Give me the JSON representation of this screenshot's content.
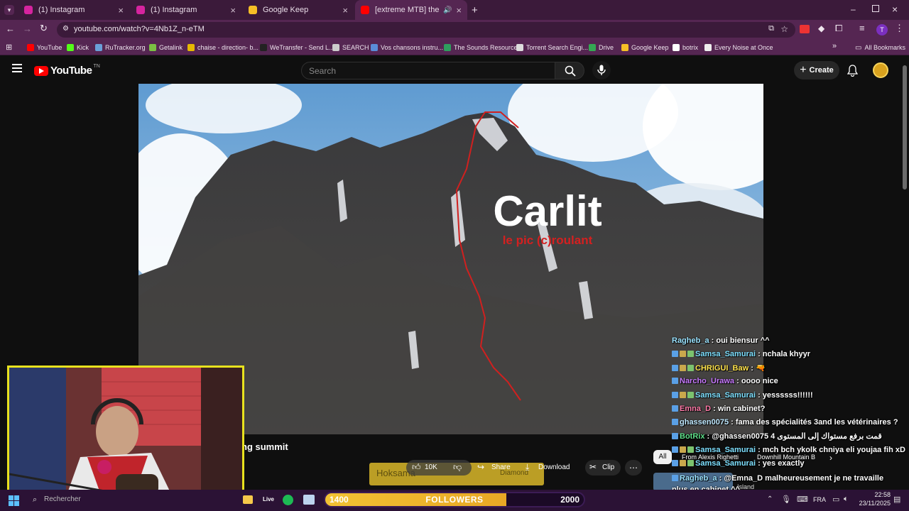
{
  "tabs": [
    {
      "title": "(1) Instagram",
      "color": "#d6249f"
    },
    {
      "title": "(1) Instagram",
      "color": "#d6249f"
    },
    {
      "title": "Google Keep",
      "color": "#f6bf26"
    },
    {
      "title": "[extreme MTB] the Carlit pe",
      "color": "#ff0000"
    }
  ],
  "browser": {
    "url": "youtube.com/watch?v=4Nb1Z_n-eTM",
    "all_bookmarks": "All Bookmarks"
  },
  "bookmarks": [
    {
      "label": "YouTube",
      "color": "#ff0000"
    },
    {
      "label": "Kick",
      "color": "#53fc18"
    },
    {
      "label": "RuTracker.org",
      "color": "#6aa0d8"
    },
    {
      "label": "Getalink",
      "color": "#7bc043"
    },
    {
      "label": "chaise - direction- b...",
      "color": "#e6b800"
    },
    {
      "label": "WeTransfer - Send L...",
      "color": "#222222"
    },
    {
      "label": "SEARCH",
      "color": "#cccccc"
    },
    {
      "label": "Vos chansons instru...",
      "color": "#5a8cd8"
    },
    {
      "label": "The Sounds Resource",
      "color": "#2e9e5e"
    },
    {
      "label": "Torrent Search Engi...",
      "color": "#dddddd"
    },
    {
      "label": "Drive",
      "color": "#34a853"
    },
    {
      "label": "Google Keep",
      "color": "#f6bf26"
    },
    {
      "label": "botrix",
      "color": "#ffffff"
    },
    {
      "label": "Every Noise at Once",
      "color": "#eeeeee"
    }
  ],
  "youtube": {
    "logo": "YouTube",
    "logo_sup": "TN",
    "search_placeholder": "Search",
    "create": "Create",
    "avatar_initials": "T"
  },
  "video": {
    "title_big": "Carlit",
    "subtitle": "le pic (c)roulant",
    "below_title": "ng summit",
    "likes": "10K",
    "share": "Share",
    "download": "Download",
    "clip": "Clip",
    "overlay_text": "Hoksama",
    "overlay_text2": "Diamond",
    "filter_all": "All",
    "rec1": "From Alexis Righetti",
    "rec2": "Downhill Mountain B",
    "rec3": "Island"
  },
  "chat": [
    {
      "user": "Ragheb_a",
      "color": "#9be3ff",
      "msg": ": oui biensur ^^"
    },
    {
      "user": "Samsa_Samurai",
      "color": "#7ee0ff",
      "msg": ": nchala khyyr"
    },
    {
      "user": "CHRIGUI_Baw",
      "color": "#ffe34d",
      "msg": ": 🔫"
    },
    {
      "user": "Narcho_Urawa",
      "color": "#c879ff",
      "msg": ": oooo nice"
    },
    {
      "user": "Samsa_Samurai",
      "color": "#7ee0ff",
      "msg": ": yessssss!!!!!!"
    },
    {
      "user": "Emna_D",
      "color": "#ff7aa8",
      "msg": ": win cabinet?"
    },
    {
      "user": "ghassen0075",
      "color": "#bfe8ff",
      "msg": ": fama des spécialités 3and les vétérinaires ?"
    },
    {
      "user": "BotRix",
      "color": "#5fe08a",
      "msg": ": @ghassen0075 قمت برفع مستواك إلى المستوى 4"
    },
    {
      "user": "Samsa_Samurai",
      "color": "#7ee0ff",
      "msg": ": mch bch ykolk chniya eli youjaa fih xD"
    },
    {
      "user": "Samsa_Samurai",
      "color": "#7ee0ff",
      "msg": ": yes exactly"
    },
    {
      "user": "Ragheb_a",
      "color": "#9be3ff",
      "msg": ": @Emna_D malheureusement je ne travaille plus en cabinet ^^"
    }
  ],
  "followers": {
    "current": "1400",
    "label": "FOLLOWERS",
    "goal": "2000",
    "progress": 0.7
  },
  "taskbar": {
    "search_placeholder": "Rechercher",
    "lang": "FRA",
    "time": "22:58",
    "date": "23/11/2025"
  }
}
